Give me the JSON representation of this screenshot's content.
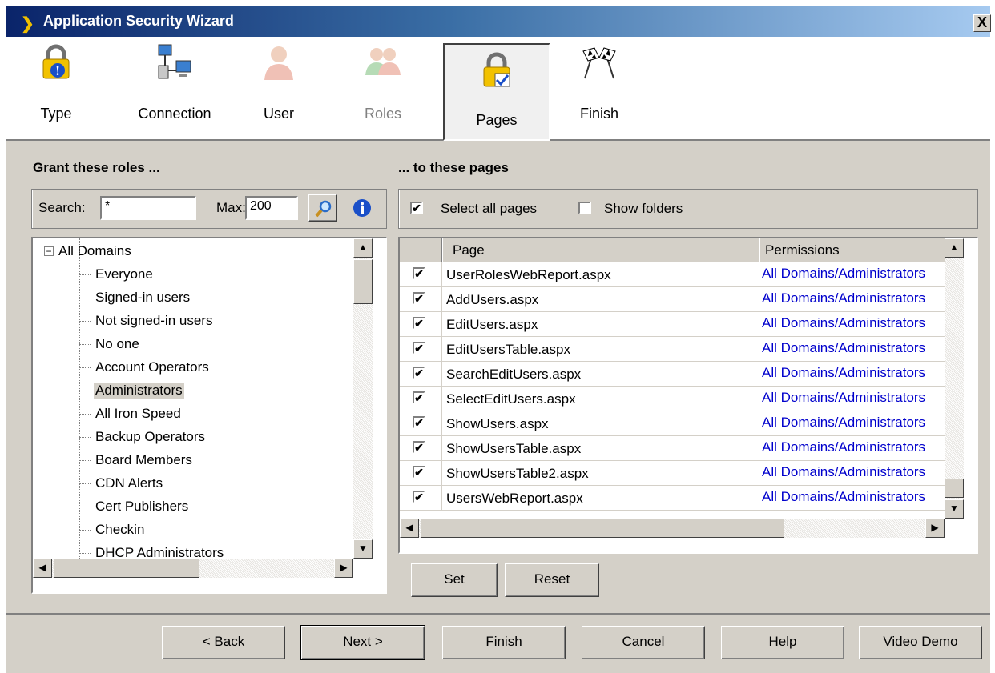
{
  "window": {
    "title": "Application Security Wizard",
    "close_label": "X"
  },
  "steps": [
    {
      "label": "Type"
    },
    {
      "label": "Connection"
    },
    {
      "label": "User"
    },
    {
      "label": "Roles"
    },
    {
      "label": "Pages"
    },
    {
      "label": "Finish"
    }
  ],
  "left": {
    "header": "Grant these roles ...",
    "search_label": "Search:",
    "search_value": "*",
    "max_label": "Max:",
    "max_value": "200",
    "tree_root": "All Domains",
    "tree_items": [
      "Everyone",
      "Signed-in users",
      "Not signed-in users",
      "No one",
      "Account Operators",
      "Administrators",
      "All Iron Speed",
      "Backup Operators",
      "Board Members",
      "CDN Alerts",
      "Cert Publishers",
      "Checkin",
      "DHCP Administrators"
    ],
    "selected_item": "Administrators"
  },
  "right": {
    "header": "... to these pages",
    "select_all_label": "Select all pages",
    "select_all_checked": true,
    "show_folders_label": "Show folders",
    "show_folders_checked": false,
    "columns": {
      "page": "Page",
      "permissions": "Permissions"
    },
    "rows": [
      {
        "page": "UserRolesWebReport.aspx",
        "permissions": "All Domains/Administrators",
        "checked": true
      },
      {
        "page": "AddUsers.aspx",
        "permissions": "All Domains/Administrators",
        "checked": true
      },
      {
        "page": "EditUsers.aspx",
        "permissions": "All Domains/Administrators",
        "checked": true
      },
      {
        "page": "EditUsersTable.aspx",
        "permissions": "All Domains/Administrators",
        "checked": true
      },
      {
        "page": "SearchEditUsers.aspx",
        "permissions": "All Domains/Administrators",
        "checked": true
      },
      {
        "page": "SelectEditUsers.aspx",
        "permissions": "All Domains/Administrators",
        "checked": true
      },
      {
        "page": "ShowUsers.aspx",
        "permissions": "All Domains/Administrators",
        "checked": true
      },
      {
        "page": "ShowUsersTable.aspx",
        "permissions": "All Domains/Administrators",
        "checked": true
      },
      {
        "page": "ShowUsersTable2.aspx",
        "permissions": "All Domains/Administrators",
        "checked": true
      },
      {
        "page": "UsersWebReport.aspx",
        "permissions": "All Domains/Administrators",
        "checked": true
      }
    ],
    "set_label": "Set",
    "reset_label": "Reset"
  },
  "footer": {
    "back": "< Back",
    "next": "Next >",
    "finish": "Finish",
    "cancel": "Cancel",
    "help": "Help",
    "video": "Video Demo"
  },
  "colors": {
    "title_start": "#0a246a",
    "title_end": "#a6caf0",
    "link": "#0000cc",
    "face": "#d4d0c8"
  },
  "icons": [
    "lock-info-icon",
    "network-computers-icon",
    "user-icon",
    "roles-icon",
    "lock-check-icon",
    "checkered-flags-icon",
    "search-icon",
    "info-icon"
  ]
}
